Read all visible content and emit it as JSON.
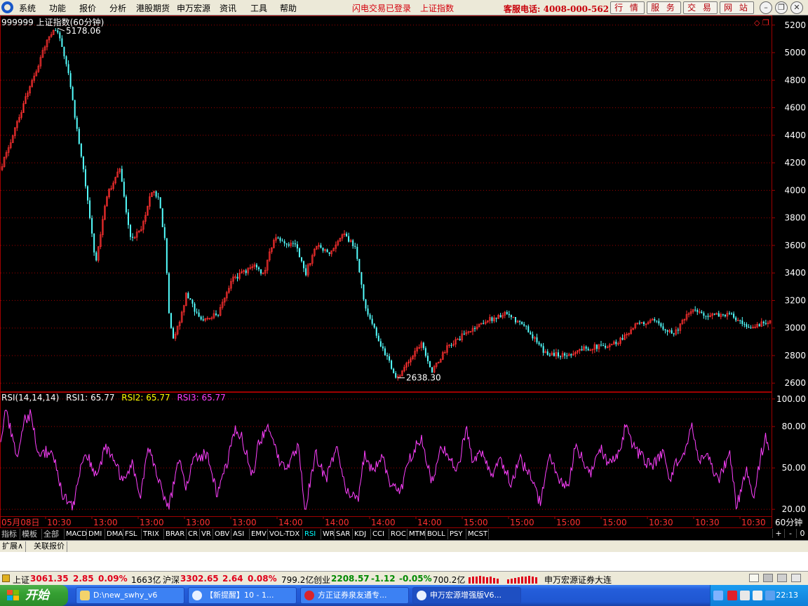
{
  "menu": {
    "items": [
      "系统",
      "功能",
      "报价",
      "分析",
      "港股期货",
      "申万宏源",
      "资讯",
      "工具",
      "帮助"
    ],
    "status_login": "闪电交易已登录",
    "status_index": "上证指数",
    "hotline": "客服电话: 4008-000-562",
    "buttons": [
      "行 情",
      "服 务",
      "交 易",
      "网 站"
    ]
  },
  "chart_data": [
    {
      "type": "candlestick",
      "title": "999999 上证指数(60分钟)",
      "y_ticks": [
        2600,
        2800,
        3000,
        3200,
        3400,
        3600,
        3800,
        4000,
        4200,
        4400,
        4600,
        4800,
        5000,
        5200
      ],
      "ylim": [
        2540,
        5260
      ],
      "annotations": [
        {
          "label": "5178.06",
          "value": 5178.06
        },
        {
          "label": "2638.30",
          "value": 2638.3
        }
      ],
      "anchors": [
        [
          0,
          4150
        ],
        [
          20,
          4450
        ],
        [
          45,
          4800
        ],
        [
          70,
          5140
        ],
        [
          80,
          5178.06
        ],
        [
          95,
          4900
        ],
        [
          110,
          4400
        ],
        [
          125,
          3900
        ],
        [
          135,
          3450
        ],
        [
          150,
          3950
        ],
        [
          170,
          4150
        ],
        [
          185,
          3650
        ],
        [
          200,
          3700
        ],
        [
          215,
          4000
        ],
        [
          225,
          3950
        ],
        [
          235,
          3600
        ],
        [
          240,
          3100
        ],
        [
          247,
          2900
        ],
        [
          265,
          3250
        ],
        [
          285,
          3050
        ],
        [
          310,
          3100
        ],
        [
          330,
          3350
        ],
        [
          360,
          3450
        ],
        [
          375,
          3400
        ],
        [
          390,
          3650
        ],
        [
          420,
          3600
        ],
        [
          435,
          3400
        ],
        [
          450,
          3600
        ],
        [
          470,
          3550
        ],
        [
          490,
          3680
        ],
        [
          505,
          3580
        ],
        [
          520,
          3150
        ],
        [
          540,
          2900
        ],
        [
          565,
          2638.3
        ],
        [
          580,
          2750
        ],
        [
          600,
          2900
        ],
        [
          615,
          2680
        ],
        [
          635,
          2850
        ],
        [
          660,
          2950
        ],
        [
          690,
          3050
        ],
        [
          720,
          3100
        ],
        [
          750,
          3000
        ],
        [
          775,
          2820
        ],
        [
          805,
          2800
        ],
        [
          830,
          2850
        ],
        [
          860,
          2870
        ],
        [
          880,
          2900
        ],
        [
          905,
          3020
        ],
        [
          930,
          3050
        ],
        [
          960,
          2960
        ],
        [
          985,
          3130
        ],
        [
          1010,
          3090
        ],
        [
          1040,
          3100
        ],
        [
          1065,
          2990
        ],
        [
          1097,
          3061.35
        ]
      ]
    },
    {
      "type": "line",
      "title": "RSI(14,14,14)",
      "series_labels": [
        {
          "label": "RSI1: 65.77",
          "color": "#ffffff"
        },
        {
          "label": "RSI2: 65.77",
          "color": "#ffff00"
        },
        {
          "label": "RSI3: 65.77",
          "color": "#ff40ff"
        }
      ],
      "y_ticks": [
        "100.00",
        "80.00",
        "50.00",
        "20.00"
      ],
      "ylim": [
        15,
        105
      ],
      "anchors": [
        [
          0,
          65
        ],
        [
          8,
          93
        ],
        [
          18,
          72
        ],
        [
          25,
          55
        ],
        [
          35,
          85
        ],
        [
          45,
          90
        ],
        [
          55,
          58
        ],
        [
          65,
          62
        ],
        [
          78,
          56
        ],
        [
          90,
          30
        ],
        [
          105,
          22
        ],
        [
          115,
          52
        ],
        [
          125,
          58
        ],
        [
          138,
          44
        ],
        [
          150,
          64
        ],
        [
          162,
          58
        ],
        [
          175,
          38
        ],
        [
          188,
          55
        ],
        [
          200,
          28
        ],
        [
          212,
          65
        ],
        [
          225,
          45
        ],
        [
          240,
          20
        ],
        [
          255,
          55
        ],
        [
          265,
          38
        ],
        [
          278,
          58
        ],
        [
          295,
          60
        ],
        [
          310,
          30
        ],
        [
          325,
          55
        ],
        [
          335,
          78
        ],
        [
          345,
          72
        ],
        [
          360,
          44
        ],
        [
          370,
          70
        ],
        [
          385,
          80
        ],
        [
          400,
          50
        ],
        [
          415,
          55
        ],
        [
          425,
          65
        ],
        [
          435,
          20
        ],
        [
          450,
          60
        ],
        [
          465,
          42
        ],
        [
          480,
          65
        ],
        [
          495,
          32
        ],
        [
          510,
          25
        ],
        [
          520,
          62
        ],
        [
          530,
          48
        ],
        [
          545,
          58
        ],
        [
          555,
          40
        ],
        [
          570,
          32
        ],
        [
          585,
          58
        ],
        [
          600,
          72
        ],
        [
          615,
          40
        ],
        [
          630,
          65
        ],
        [
          640,
          60
        ],
        [
          650,
          44
        ],
        [
          665,
          78
        ],
        [
          675,
          52
        ],
        [
          685,
          62
        ],
        [
          700,
          44
        ],
        [
          715,
          55
        ],
        [
          730,
          38
        ],
        [
          740,
          58
        ],
        [
          755,
          44
        ],
        [
          770,
          25
        ],
        [
          785,
          60
        ],
        [
          795,
          42
        ],
        [
          810,
          35
        ],
        [
          820,
          64
        ],
        [
          830,
          58
        ],
        [
          840,
          44
        ],
        [
          855,
          65
        ],
        [
          870,
          52
        ],
        [
          880,
          58
        ],
        [
          892,
          80
        ],
        [
          905,
          64
        ],
        [
          915,
          58
        ],
        [
          930,
          50
        ],
        [
          945,
          62
        ],
        [
          955,
          42
        ],
        [
          965,
          55
        ],
        [
          975,
          58
        ],
        [
          985,
          82
        ],
        [
          995,
          58
        ],
        [
          1010,
          56
        ],
        [
          1025,
          40
        ],
        [
          1040,
          62
        ],
        [
          1050,
          22
        ],
        [
          1065,
          48
        ],
        [
          1075,
          30
        ],
        [
          1085,
          60
        ],
        [
          1092,
          72
        ],
        [
          1097,
          65.77
        ]
      ]
    }
  ],
  "x_axis": {
    "labels": [
      "05月08日",
      "10:30",
      "13:00",
      "13:00",
      "13:00",
      "13:00",
      "14:00",
      "14:00",
      "14:00",
      "14:00",
      "15:00",
      "15:00",
      "15:00",
      "15:00",
      "10:30",
      "10:30",
      "10:30"
    ],
    "period": "60分钟"
  },
  "indicator_tabs": {
    "cn": [
      "指标",
      "模板",
      "全部"
    ],
    "en": [
      "MACD",
      "DMI",
      "DMA",
      "FSL",
      "TRIX",
      "BRAR",
      "CR",
      "VR",
      "OBV",
      "ASI",
      "EMV",
      "VOL-TDX",
      "RSI",
      "WR",
      "SAR",
      "KDJ",
      "CCI",
      "ROC",
      "MTM",
      "BOLL",
      "PSY",
      "MCST"
    ],
    "active": "RSI",
    "right": [
      "+",
      "-",
      "0"
    ]
  },
  "ext_tabs": [
    "扩展∧",
    "关联报价"
  ],
  "quotes": [
    {
      "name": "上证",
      "price": "3061.35",
      "change": "2.85",
      "pct": "0.09%",
      "amount": "1663亿"
    },
    {
      "name": "沪深",
      "price": "3302.65",
      "change": "2.64",
      "pct": "0.08%",
      "amount": "799.2亿"
    },
    {
      "name": "创业",
      "price": "2208.57",
      "change": "-1.12",
      "pct": "-0.05%",
      "amount": "700.2亿"
    }
  ],
  "broker": "申万宏源证券大连",
  "taskbar": {
    "start": "开始",
    "tasks": [
      "D:\\new_swhy_v6",
      "【新提醒】10 - 1...",
      "方正证券泉友通专...",
      "申万宏源增强版V6..."
    ],
    "clock": "22:13"
  },
  "colors": {
    "up": "#ff3030",
    "down": "#54ffff",
    "rsi": "#ff40ff",
    "grid": "#a00000"
  }
}
